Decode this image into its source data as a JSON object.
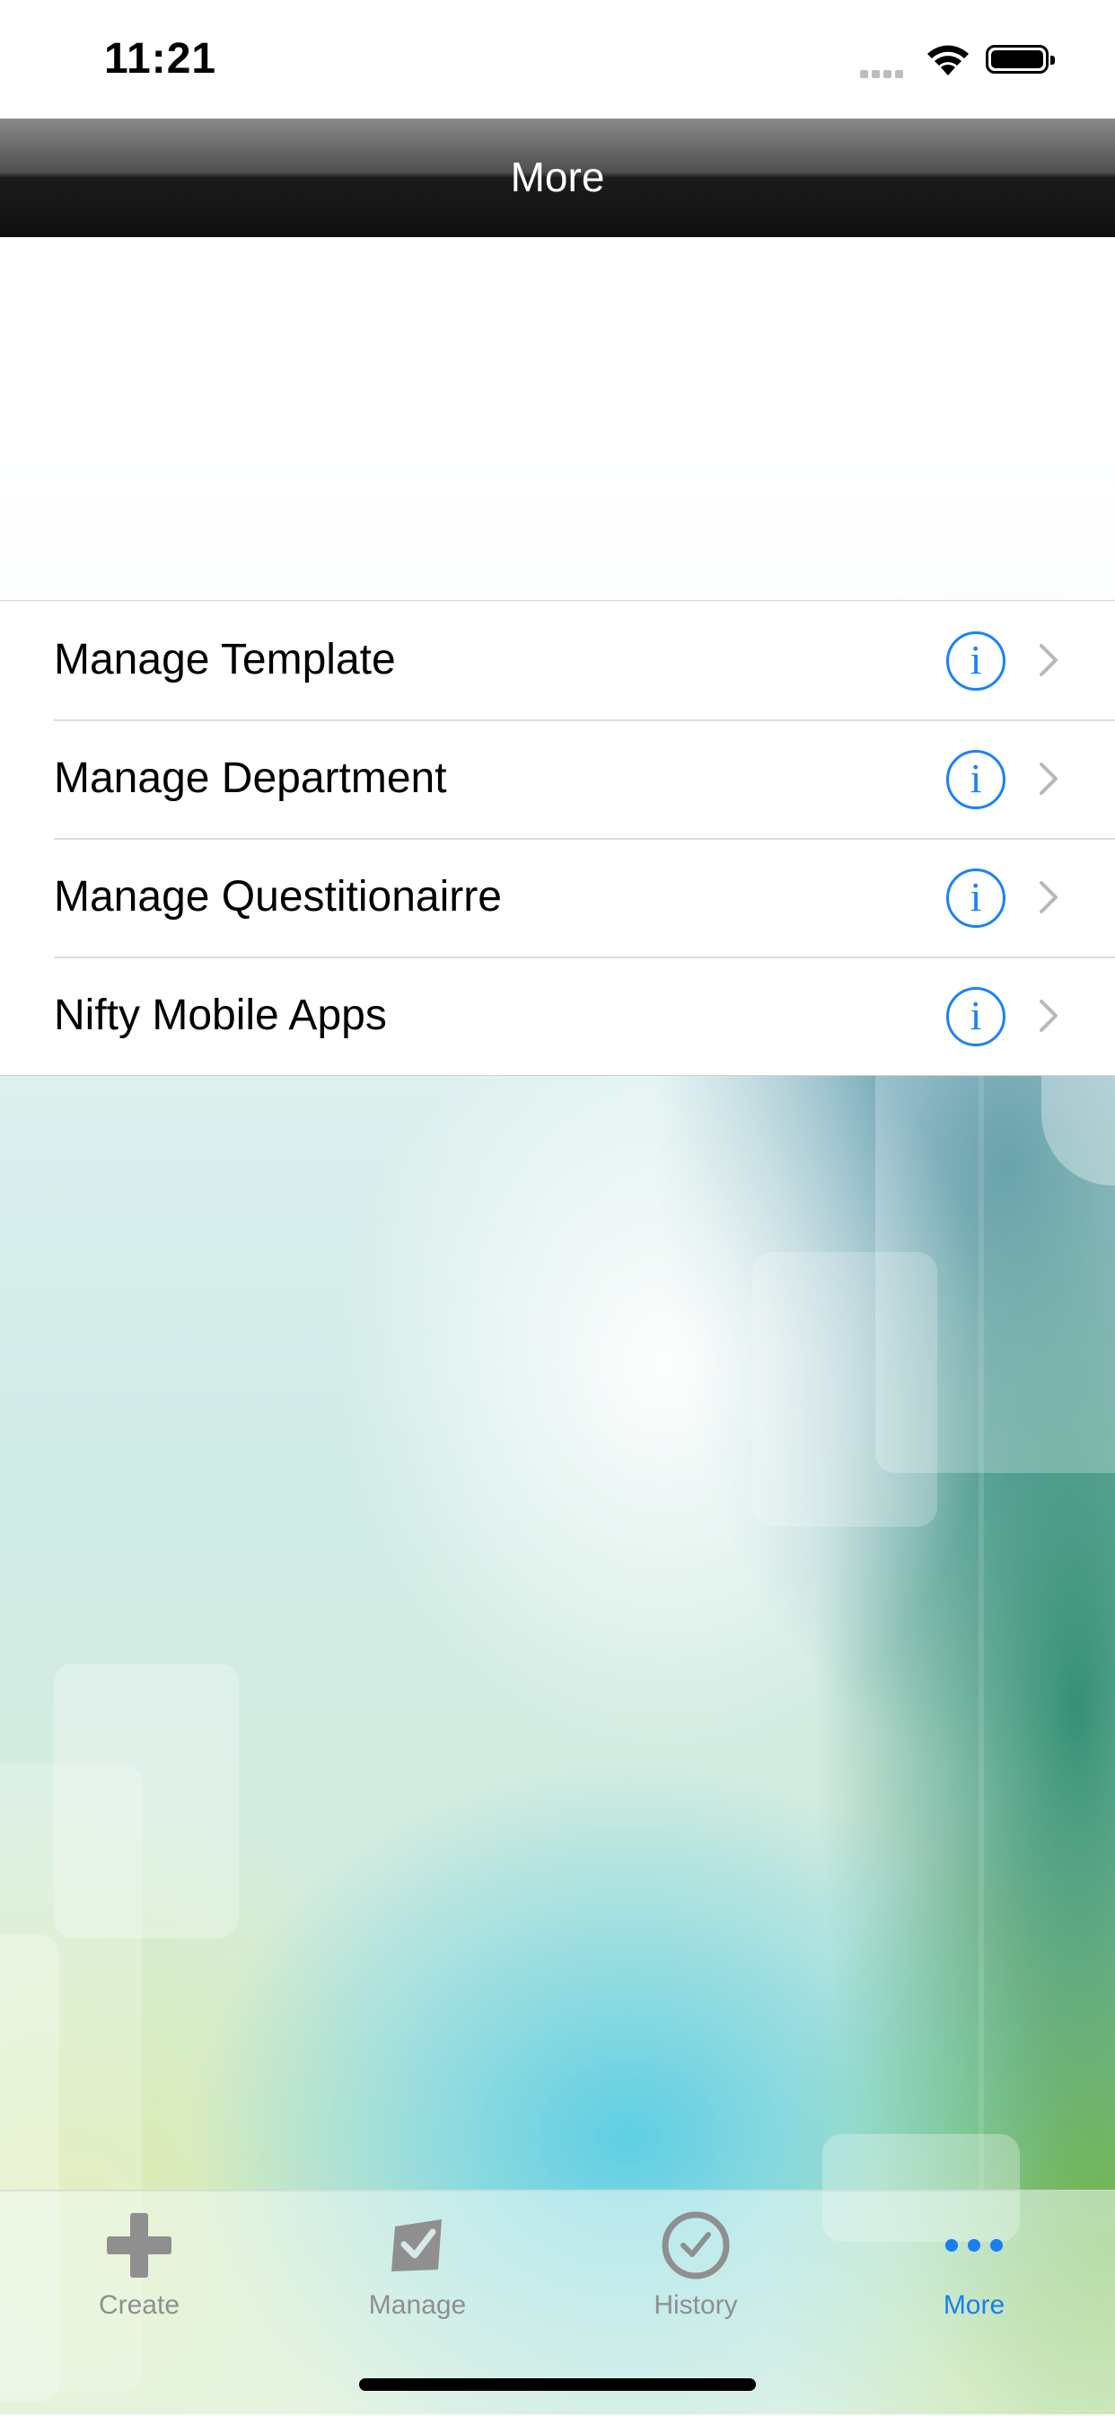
{
  "status_bar": {
    "time": "11:21"
  },
  "nav": {
    "title": "More"
  },
  "menu": {
    "items": [
      {
        "label": "Manage Template"
      },
      {
        "label": "Manage Department"
      },
      {
        "label": "Manage Questitionairre"
      },
      {
        "label": "Nifty Mobile Apps"
      }
    ],
    "info_glyph": "i"
  },
  "tabs": [
    {
      "label": "Create",
      "icon": "plus-icon",
      "active": false
    },
    {
      "label": "Manage",
      "icon": "checked-box-icon",
      "active": false
    },
    {
      "label": "History",
      "icon": "clock-check-icon",
      "active": false
    },
    {
      "label": "More",
      "icon": "ellipsis-icon",
      "active": true
    }
  ],
  "colors": {
    "accent": "#1a82f7",
    "tab_inactive": "#8f8f8f",
    "navbar": "#0f0f10"
  }
}
